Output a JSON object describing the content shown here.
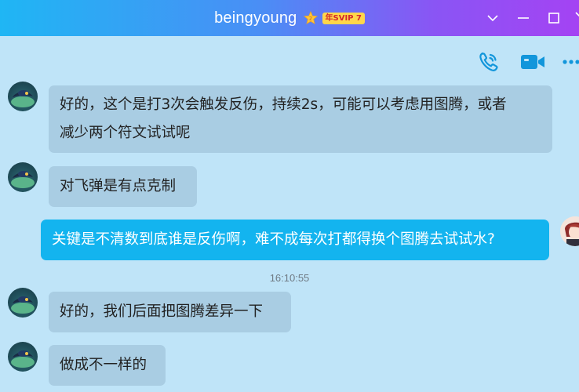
{
  "window": {
    "title": "beingyoung",
    "vip_badge": "年SVIP 7",
    "controls": [
      "chevron-down-icon",
      "minimize-icon",
      "maximize-icon",
      "close-icon"
    ]
  },
  "toolbar": {
    "icons": [
      "phone-call-icon",
      "video-call-icon",
      "more-icon"
    ]
  },
  "colors": {
    "title_gradient_start": "#1fb6f4",
    "title_gradient_end": "#a443f3",
    "chat_background": "#bfe4f8",
    "incoming_bubble": "#a9cde3",
    "outgoing_bubble": "#13b4ef",
    "icon_accent": "#1296db"
  },
  "messages": [
    {
      "side": "in",
      "text_line1": "好的，这个是打3次会触发反伤，持续2s，可能可以考虑用图腾，或者",
      "text_line2": "减少两个符文试试呢"
    },
    {
      "side": "in",
      "text": "对飞弹是有点克制"
    },
    {
      "side": "out",
      "text": "关键是不清数到底谁是反伤啊，难不成每次打都得换个图腾去试试水?"
    },
    {
      "side": "in",
      "text": "好的，我们后面把图腾差异一下"
    },
    {
      "side": "in",
      "text": "做成不一样的"
    }
  ],
  "timestamp": "16:10:55"
}
